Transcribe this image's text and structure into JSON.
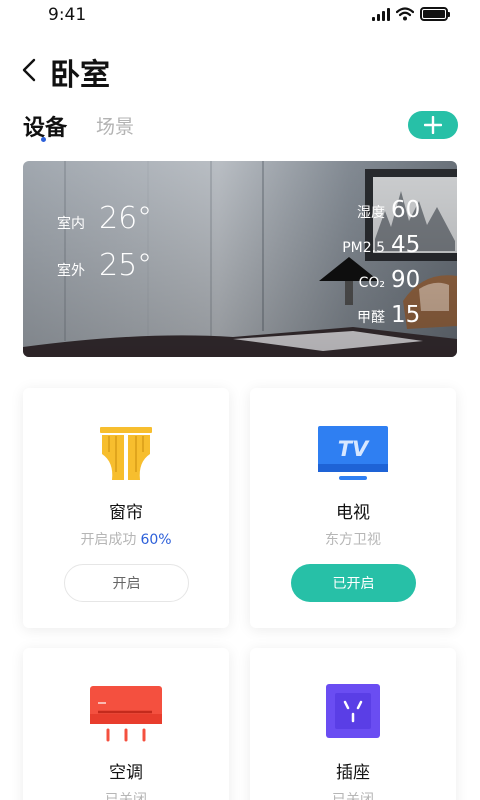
{
  "status_bar": {
    "time": "9:41"
  },
  "header": {
    "title": "卧室"
  },
  "tabs": [
    {
      "label": "设备",
      "active": true
    },
    {
      "label": "场景",
      "active": false
    }
  ],
  "environment": {
    "indoor": {
      "label": "室内",
      "value": "26°"
    },
    "outdoor": {
      "label": "室外",
      "value": "25°"
    },
    "humidity": {
      "label": "湿度",
      "value": "60"
    },
    "pm25": {
      "label": "PM2.5",
      "value": "45"
    },
    "co2": {
      "label": "CO₂",
      "value": "90"
    },
    "formaldehyde": {
      "label": "甲醛",
      "value": "15"
    }
  },
  "devices": [
    {
      "name": "窗帘",
      "status": "开启成功",
      "percent": "60%",
      "button": "开启",
      "icon": "curtain-icon"
    },
    {
      "name": "电视",
      "status": "东方卫视",
      "button": "已开启",
      "icon": "tv-icon",
      "icon_text": "TV"
    },
    {
      "name": "空调",
      "status": "已关闭",
      "icon": "air-conditioner-icon"
    },
    {
      "name": "插座",
      "status": "已关闭",
      "icon": "socket-icon"
    }
  ],
  "colors": {
    "accent": "#27c0a7",
    "blue": "#2c5fd9",
    "curtain": "#f7be2e",
    "tv": "#2f7ff2",
    "ac": "#f4503f",
    "socket": "#6a4df2"
  }
}
